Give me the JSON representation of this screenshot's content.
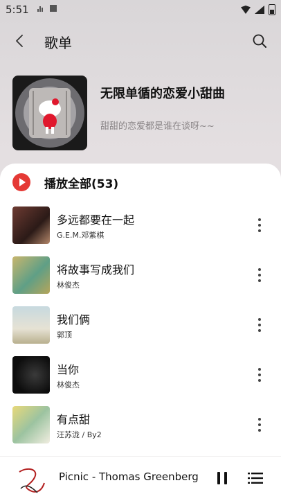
{
  "status": {
    "time": "5:51"
  },
  "header": {
    "title": "歌单"
  },
  "playlist": {
    "name": "无限单循的恋爱小甜曲",
    "description": "甜甜的恋爱都是谁在谈呀~~"
  },
  "play_all": {
    "label": "播放全部(53)"
  },
  "songs": [
    {
      "title": "多远都要在一起",
      "artist": "G.E.M.邓紫棋"
    },
    {
      "title": "将故事写成我们",
      "artist": "林俊杰"
    },
    {
      "title": "我们俩",
      "artist": "郭顶"
    },
    {
      "title": "当你",
      "artist": "林俊杰"
    },
    {
      "title": "有点甜",
      "artist": "汪苏泷 / By2"
    }
  ],
  "player": {
    "now_playing": "Picnic - Thomas Greenberg"
  },
  "colors": {
    "accent": "#e53935",
    "background": "#e6e1e3",
    "sheet": "#ffffff"
  }
}
